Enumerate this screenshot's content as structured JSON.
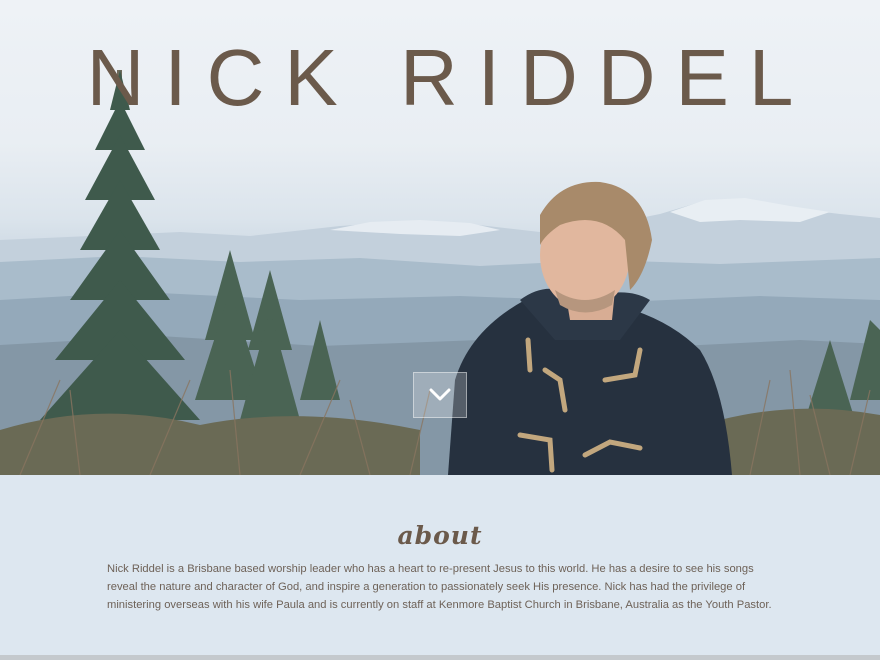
{
  "hero": {
    "title": "NICK RIDDEL",
    "scroll_icon": "chevron-down-icon"
  },
  "about": {
    "heading": "about",
    "body": "Nick Riddel is a Brisbane based worship leader who has a heart to re-present Jesus to this world. He has a desire to see his songs reveal the nature and character of God, and inspire a generation to passionately seek His presence. Nick has had the privilege of ministering overseas with his wife Paula and is currently on staff at Kenmore Baptist Church in Brisbane, Australia as the Youth Pastor."
  },
  "colors": {
    "title": "#6b5a4b",
    "about_bg": "#dde7f0",
    "body_text": "#6e6258"
  }
}
